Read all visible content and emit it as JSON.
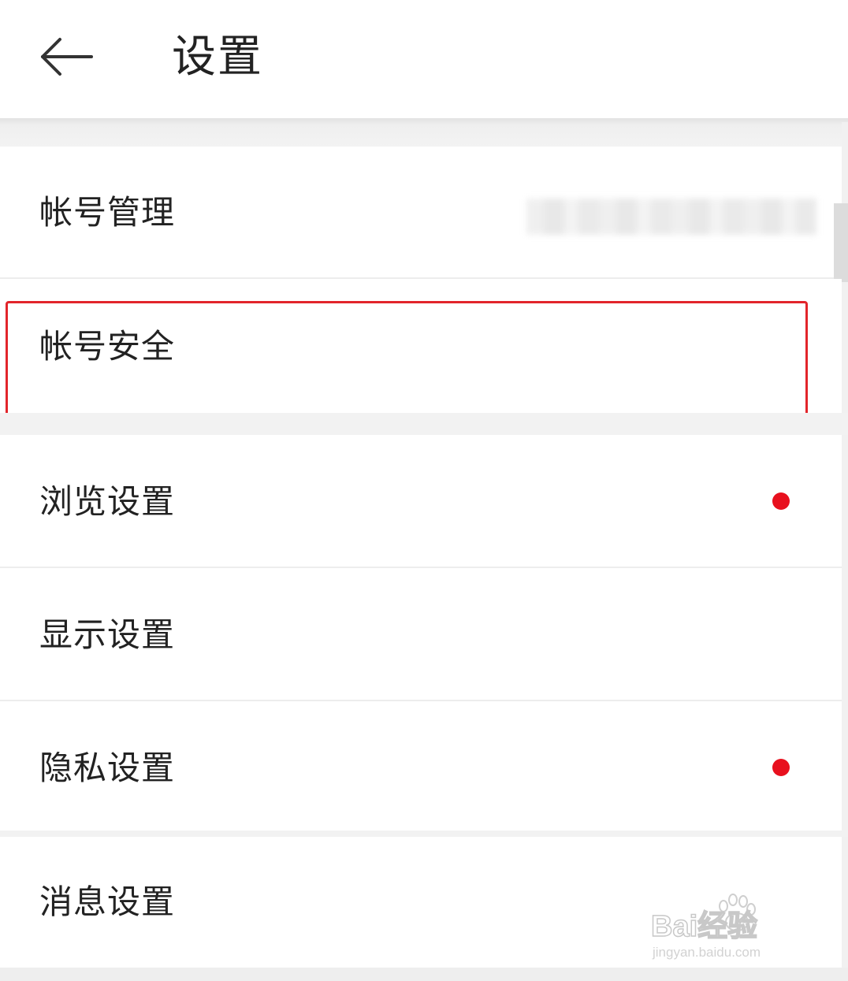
{
  "header": {
    "title": "设置",
    "back_icon": "arrow-left-icon"
  },
  "settings": {
    "items": [
      {
        "label": "帐号管理",
        "value": "(blurred)",
        "has_badge": false
      },
      {
        "label": "帐号安全",
        "has_badge": false,
        "highlighted": true
      },
      {
        "label": "浏览设置",
        "has_badge": true
      },
      {
        "label": "显示设置",
        "has_badge": false
      },
      {
        "label": "隐私设置",
        "has_badge": true
      },
      {
        "label": "消息设置",
        "has_badge": false
      }
    ]
  },
  "colors": {
    "badge": "#e8101e",
    "highlight_border": "#e2252b",
    "text": "#222222",
    "separator": "#f2f2f2"
  },
  "watermark": {
    "brand": "Bai经验",
    "url": "jingyan.baidu.com"
  }
}
